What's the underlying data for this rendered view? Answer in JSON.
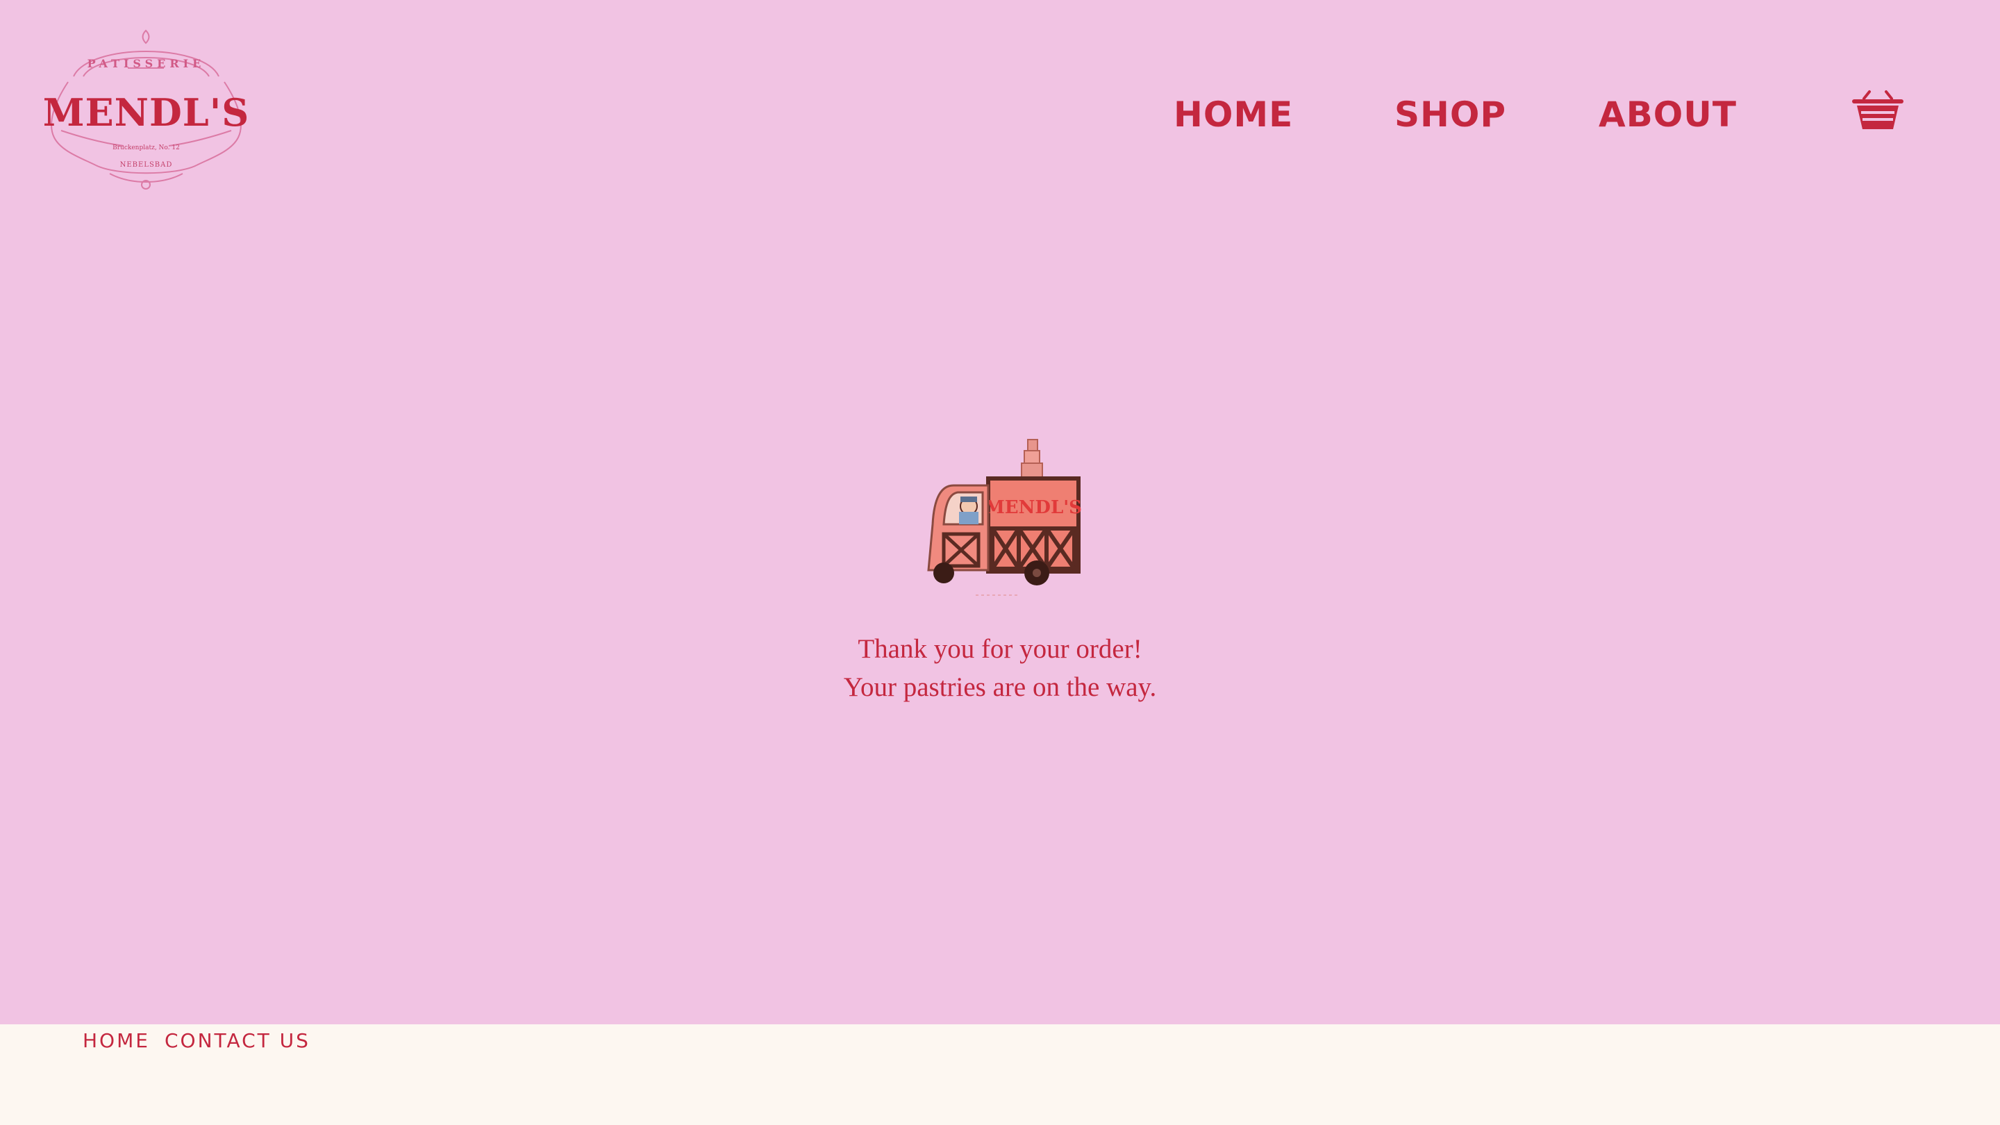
{
  "brand": {
    "name": "MENDL'S",
    "tagline": "PATISSERIE",
    "address": "Bruckenplatz, No. 12",
    "city": "NEBELSBAD",
    "color": "#c4273f",
    "background": "#f1c3e3"
  },
  "nav": {
    "items": [
      {
        "label": "HOME"
      },
      {
        "label": "SHOP"
      },
      {
        "label": "ABOUT"
      }
    ],
    "cart_icon": "basket-icon"
  },
  "confirmation": {
    "illustration": "delivery-truck-illustration",
    "truck_label": "MENDL'S",
    "line1": "Thank you for your order!",
    "line2": "Your pastries are on the way."
  },
  "footer": {
    "links": [
      {
        "label": "HOME"
      },
      {
        "label": "CONTACT US"
      }
    ],
    "background": "#fdf7f1"
  }
}
